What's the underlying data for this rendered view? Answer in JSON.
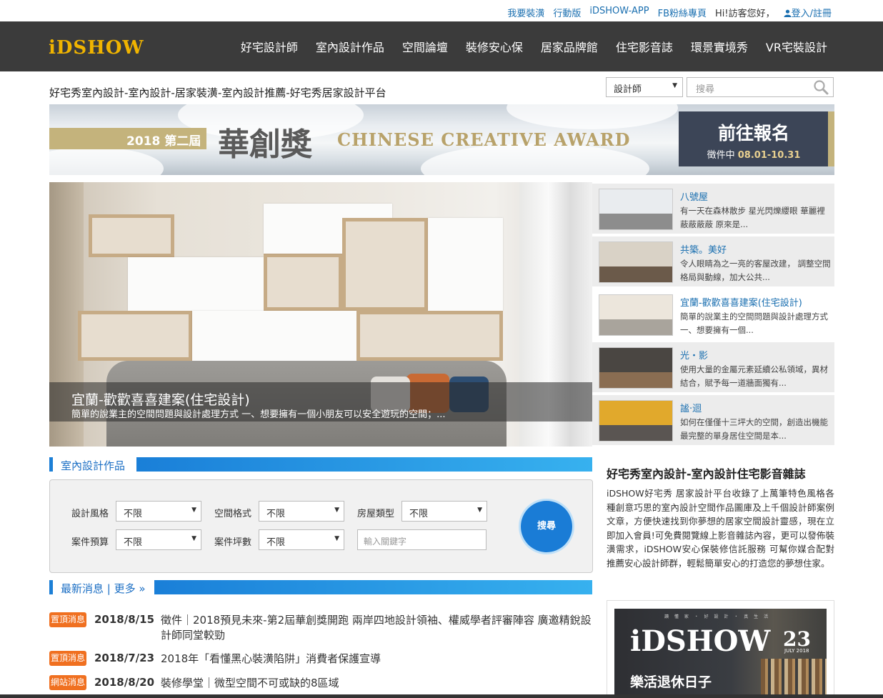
{
  "topbar": {
    "links": [
      "我要裝潢",
      "行動版",
      "iDSHOW-APP",
      "FB粉絲專頁"
    ],
    "greeting": "Hi!訪客您好，",
    "login": "登入/註冊"
  },
  "logo": {
    "text": "iDSHOW"
  },
  "nav": [
    "好宅設計師",
    "室內設計作品",
    "空間論壇",
    "裝修安心保",
    "居家品牌館",
    "住宅影音誌",
    "環景實境秀",
    "VR宅裝設計"
  ],
  "site_title": "好宅秀室內設計-室內設計-居家裝潢-室內設計推薦-好宅秀居家設計平台",
  "search": {
    "category": "設計師",
    "placeholder": "搜尋"
  },
  "banner": {
    "edition": "2018 第二屆",
    "title": "華創獎",
    "english": "CHINESE CREATIVE AWARD",
    "cta": "前往報名",
    "cta_sub_label": "徵件中",
    "cta_sub_dates": "08.01-10.31"
  },
  "hero": {
    "title": "宜蘭-歡歡喜喜建案(住宅設計)",
    "desc": "簡單的說業主的空間問題與設計處理方式 一、想要擁有一個小朋友可以安全遊玩的空間；..."
  },
  "side_items": [
    {
      "title": "八號屋",
      "desc": "有一天在森林散步 星光閃爍纓眼 華麗裡蔽蔽蔽蔽 原來是..."
    },
    {
      "title": "共築。美好",
      "desc": "令人眼睛為之一亮的客屋改建， 調整空間格局與動線，加大公共..."
    },
    {
      "title": "宜蘭-歡歡喜喜建案(住宅設計)",
      "desc": "簡單的說業主的空間問題與設計處理方式 一、想要擁有一個..."
    },
    {
      "title": "光・影",
      "desc": "使用大量的金屬元素延續公私領域，異材結合，賦予每一道牆面獨有..."
    },
    {
      "title": "謐·迴",
      "desc": "如何在僅僅十三坪大的空間，創造出機能最完整的單身居住空間是本..."
    }
  ],
  "works_section": {
    "title": "室內設計作品"
  },
  "filter": {
    "style_label": "設計風格",
    "style_value": "不限",
    "layout_label": "空間格式",
    "layout_value": "不限",
    "house_label": "房屋類型",
    "house_value": "不限",
    "budget_label": "案件預算",
    "budget_value": "不限",
    "size_label": "案件坪數",
    "size_value": "不限",
    "keyword_placeholder": "輸入關鍵字",
    "search_button": "搜尋"
  },
  "news_section": {
    "title": "最新消息 | 更多 »"
  },
  "news": [
    {
      "badge": "置頂消息",
      "date": "2018/8/15",
      "text": "徵件｜2018預見未來-第2屆華創獎開跑 兩岸四地設計領袖、權威學者評審陣容 廣邀精銳設計師同堂較勁"
    },
    {
      "badge": "置頂消息",
      "date": "2018/7/23",
      "text": "2018年「看懂黑心裝潢陷阱」消費者保護宣導"
    },
    {
      "badge": "網站消息",
      "date": "2018/8/20",
      "text": "裝修學堂｜微型空間不可或缺的8區域"
    }
  ],
  "about": {
    "title": "好宅秀室內設計-室內設計住宅影音雜誌",
    "text": "iDSHOW好宅秀 居家設計平台收錄了上萬筆特色風格各種創意巧思的室內設計空間作品圖庫及上千個設計師案例文章，方便快速找到你夢想的居家空間設計靈感，現在立即加入會員!可免費閱覽線上影音雜誌內容，更可以發佈裝潢需求，iDSHOW安心保裝修信託服務 可幫你媒合配對推薦安心設計師群，輕鬆簡單安心的打造您的夢想住家。"
  },
  "magazine": {
    "brand": "iDSHOW",
    "issue": "23",
    "month": "JULY 2018",
    "tagline": "讀 懂 家 ・ 好 設 計 ・ 真 生 活",
    "cover_text": "樂活退休日子"
  },
  "colors": {
    "nav_bg": "#3b3b3b",
    "logo": "#f0b400",
    "accent_blue": "#1c7fd6",
    "badge_orange": "#f07020",
    "link_blue": "#1a6fb0"
  }
}
